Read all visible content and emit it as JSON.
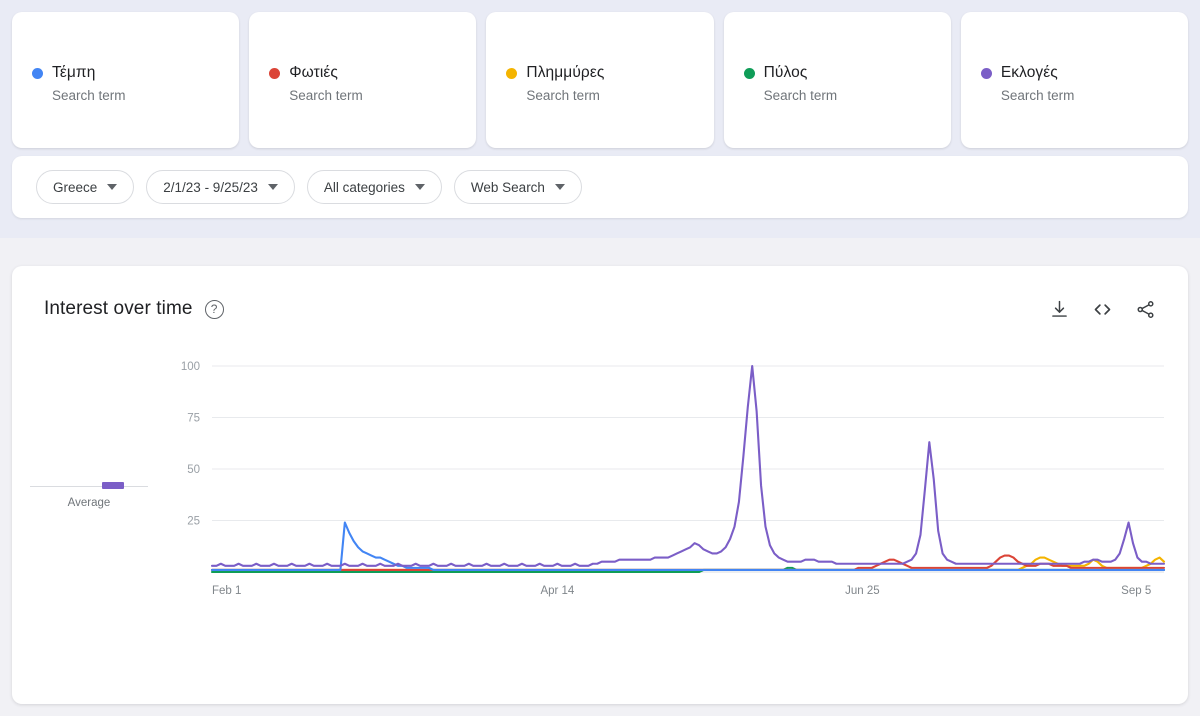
{
  "terms": [
    {
      "name": "Τέμπη",
      "subtitle": "Search term",
      "color": "#4285f4"
    },
    {
      "name": "Φωτιές",
      "subtitle": "Search term",
      "color": "#db4437"
    },
    {
      "name": "Πλημμύρες",
      "subtitle": "Search term",
      "color": "#f4b400"
    },
    {
      "name": "Πύλος",
      "subtitle": "Search term",
      "color": "#0f9d58"
    },
    {
      "name": "Εκλογές",
      "subtitle": "Search term",
      "color": "#7b5ec7"
    }
  ],
  "filters": [
    {
      "label": "Greece",
      "name": "region-filter"
    },
    {
      "label": "2/1/23 - 9/25/23",
      "name": "date-range-filter"
    },
    {
      "label": "All categories",
      "name": "category-filter"
    },
    {
      "label": "Web Search",
      "name": "search-type-filter"
    }
  ],
  "panel": {
    "title": "Interest over time",
    "help": "?",
    "average_label": "Average",
    "actions": [
      "download-icon",
      "embed-code-icon",
      "share-icon"
    ]
  },
  "chart_data": {
    "type": "line",
    "title": "Interest over time",
    "xlabel": "",
    "ylabel": "",
    "ylim": [
      0,
      100
    ],
    "yticks": [
      25,
      50,
      75,
      100
    ],
    "grid": true,
    "legend_position": "top-cards",
    "xticks": [
      "Feb 1",
      "Apr 14",
      "Jun 25",
      "Sep 5"
    ],
    "xtick_positions": [
      0,
      0.345,
      0.665,
      0.955
    ],
    "date_range": "2/1/23 - 9/25/23",
    "region": "Greece",
    "series": [
      {
        "name": "Τέμπη",
        "color": "#4285f4",
        "values": [
          1,
          1,
          1,
          1,
          1,
          1,
          1,
          1,
          1,
          1,
          1,
          1,
          1,
          1,
          1,
          1,
          1,
          1,
          1,
          1,
          1,
          1,
          1,
          1,
          1,
          1,
          1,
          1,
          1,
          1,
          24,
          19,
          15,
          12,
          10,
          9,
          8,
          7,
          7,
          6,
          5,
          4,
          3,
          3,
          2,
          2,
          2,
          2,
          2,
          2,
          1,
          1,
          1,
          1,
          1,
          1,
          1,
          1,
          1,
          1,
          1,
          1,
          1,
          1,
          1,
          1,
          1,
          1,
          1,
          1,
          1,
          1,
          1,
          1,
          1,
          1,
          1,
          1,
          1,
          1,
          1,
          1,
          1,
          1,
          1,
          1,
          1,
          1,
          1,
          1,
          1,
          1,
          1,
          1,
          1,
          1,
          1,
          1,
          1,
          1,
          1,
          1,
          1,
          1,
          1,
          1,
          1,
          1,
          1,
          1,
          1,
          1,
          1,
          1,
          1,
          1,
          1,
          1,
          1,
          1,
          1,
          1,
          1,
          1,
          1,
          1,
          1,
          1,
          1,
          1,
          1,
          1,
          1,
          1,
          1,
          1,
          1,
          1,
          1,
          1,
          1,
          1,
          1,
          1,
          1,
          1,
          1,
          1,
          1,
          1,
          1,
          1,
          1,
          1,
          1,
          1,
          1,
          1,
          1,
          1,
          1,
          1,
          1,
          1,
          1,
          1,
          1,
          1,
          1,
          1,
          1,
          1,
          1,
          1,
          1,
          1,
          1,
          1,
          1,
          1,
          1,
          1,
          1,
          1,
          1,
          1,
          1,
          1,
          1,
          1,
          1,
          1,
          1,
          1,
          1,
          1,
          1,
          1,
          1,
          1,
          1,
          1,
          1,
          1,
          1,
          1,
          1,
          1,
          1,
          1,
          1,
          1,
          1,
          1,
          1,
          1
        ]
      },
      {
        "name": "Φωτιές",
        "color": "#db4437",
        "values": [
          1,
          1,
          1,
          1,
          1,
          1,
          1,
          1,
          1,
          1,
          1,
          1,
          1,
          1,
          1,
          1,
          1,
          1,
          1,
          1,
          1,
          1,
          1,
          1,
          1,
          1,
          1,
          1,
          1,
          1,
          1,
          1,
          1,
          1,
          1,
          1,
          1,
          1,
          1,
          1,
          1,
          1,
          1,
          1,
          1,
          1,
          1,
          1,
          1,
          1,
          1,
          1,
          1,
          1,
          1,
          1,
          1,
          1,
          1,
          1,
          1,
          1,
          1,
          1,
          1,
          1,
          1,
          1,
          1,
          1,
          1,
          1,
          1,
          1,
          1,
          1,
          1,
          1,
          1,
          1,
          1,
          1,
          1,
          1,
          1,
          1,
          1,
          1,
          1,
          1,
          1,
          1,
          1,
          1,
          1,
          1,
          1,
          1,
          1,
          1,
          1,
          1,
          1,
          1,
          1,
          1,
          1,
          1,
          1,
          1,
          1,
          1,
          1,
          1,
          1,
          1,
          1,
          1,
          1,
          1,
          1,
          1,
          1,
          1,
          1,
          1,
          1,
          1,
          1,
          1,
          1,
          1,
          1,
          1,
          1,
          1,
          1,
          1,
          1,
          1,
          1,
          1,
          1,
          1,
          1,
          1,
          2,
          2,
          2,
          2,
          3,
          4,
          5,
          6,
          6,
          5,
          4,
          3,
          2,
          2,
          2,
          2,
          2,
          2,
          2,
          2,
          2,
          2,
          2,
          2,
          2,
          2,
          2,
          2,
          2,
          2,
          3,
          5,
          7,
          8,
          8,
          7,
          5,
          4,
          3,
          3,
          3,
          4,
          4,
          4,
          3,
          3,
          3,
          3,
          2,
          2,
          2,
          2,
          2,
          2,
          2,
          2,
          2,
          2,
          2,
          2,
          2,
          2,
          2,
          2,
          2,
          2,
          2,
          2,
          2,
          2
        ]
      },
      {
        "name": "Πλημμύρες",
        "color": "#f4b400",
        "values": [
          1,
          1,
          1,
          1,
          1,
          1,
          1,
          1,
          1,
          1,
          1,
          1,
          1,
          1,
          1,
          1,
          1,
          1,
          1,
          1,
          1,
          1,
          1,
          1,
          1,
          1,
          1,
          1,
          1,
          1,
          1,
          1,
          1,
          1,
          1,
          1,
          1,
          1,
          1,
          1,
          1,
          1,
          1,
          1,
          1,
          1,
          1,
          1,
          1,
          1,
          1,
          1,
          1,
          1,
          1,
          1,
          1,
          1,
          1,
          1,
          1,
          1,
          1,
          1,
          1,
          1,
          1,
          1,
          1,
          1,
          1,
          1,
          1,
          1,
          1,
          1,
          1,
          1,
          1,
          1,
          1,
          1,
          1,
          1,
          1,
          1,
          1,
          1,
          1,
          1,
          1,
          1,
          1,
          1,
          1,
          1,
          1,
          1,
          1,
          1,
          1,
          1,
          1,
          1,
          1,
          1,
          1,
          1,
          1,
          1,
          1,
          1,
          1,
          1,
          1,
          1,
          1,
          1,
          1,
          1,
          1,
          1,
          1,
          1,
          1,
          1,
          1,
          1,
          1,
          1,
          1,
          1,
          1,
          1,
          1,
          1,
          1,
          1,
          1,
          1,
          1,
          1,
          1,
          1,
          1,
          1,
          1,
          1,
          1,
          1,
          1,
          1,
          1,
          1,
          1,
          1,
          1,
          1,
          1,
          1,
          1,
          1,
          1,
          1,
          1,
          1,
          1,
          1,
          1,
          1,
          1,
          1,
          1,
          1,
          1,
          1,
          1,
          1,
          1,
          1,
          1,
          1,
          1,
          2,
          3,
          4,
          6,
          7,
          7,
          6,
          5,
          4,
          3,
          3,
          3,
          3,
          3,
          3,
          4,
          6,
          5,
          3,
          2,
          2,
          2,
          2,
          2,
          2,
          2,
          2,
          2,
          3,
          4,
          6,
          7,
          5
        ]
      },
      {
        "name": "Πύλος",
        "color": "#0f9d58",
        "values": [
          0,
          0,
          0,
          0,
          0,
          0,
          0,
          0,
          0,
          0,
          0,
          0,
          0,
          0,
          0,
          0,
          0,
          0,
          0,
          0,
          0,
          0,
          0,
          0,
          0,
          0,
          0,
          0,
          0,
          0,
          0,
          0,
          0,
          0,
          0,
          0,
          0,
          0,
          0,
          0,
          0,
          0,
          0,
          0,
          0,
          0,
          0,
          0,
          0,
          0,
          0,
          0,
          0,
          0,
          0,
          0,
          0,
          0,
          0,
          0,
          0,
          0,
          0,
          0,
          0,
          0,
          0,
          0,
          0,
          0,
          0,
          0,
          0,
          0,
          0,
          0,
          0,
          0,
          0,
          0,
          0,
          0,
          0,
          0,
          0,
          0,
          0,
          0,
          0,
          0,
          0,
          0,
          0,
          0,
          0,
          0,
          0,
          0,
          0,
          0,
          0,
          0,
          0,
          0,
          0,
          0,
          0,
          0,
          0,
          0,
          0,
          1,
          1,
          1,
          1,
          1,
          1,
          1,
          1,
          1,
          1,
          1,
          1,
          1,
          1,
          1,
          1,
          1,
          1,
          1,
          2,
          2,
          1,
          1,
          1,
          1,
          1,
          1,
          1,
          1,
          1,
          1,
          1,
          1,
          1,
          1,
          1,
          1,
          1,
          1,
          1,
          1,
          1,
          1,
          1,
          1,
          1,
          1,
          1,
          1,
          1,
          1,
          1,
          1,
          1,
          1,
          1,
          1,
          1,
          1,
          1,
          1,
          1,
          1,
          1,
          1,
          1,
          1,
          1,
          1,
          1,
          1,
          1,
          1,
          1,
          1,
          1,
          1,
          1,
          1,
          1,
          1,
          1,
          1,
          1,
          1,
          1,
          1,
          1,
          1,
          1,
          1,
          1,
          1,
          1,
          1,
          1,
          1,
          1,
          1,
          1,
          1,
          1,
          1,
          1,
          1
        ]
      },
      {
        "name": "Εκλογές",
        "color": "#7b5ec7",
        "values": [
          3,
          3,
          4,
          3,
          3,
          3,
          4,
          3,
          3,
          3,
          4,
          3,
          3,
          3,
          4,
          3,
          3,
          3,
          4,
          3,
          3,
          3,
          4,
          3,
          3,
          3,
          4,
          3,
          3,
          3,
          4,
          3,
          3,
          3,
          4,
          3,
          3,
          3,
          4,
          3,
          3,
          3,
          4,
          3,
          3,
          3,
          4,
          3,
          3,
          3,
          4,
          3,
          3,
          3,
          4,
          3,
          3,
          3,
          4,
          3,
          3,
          3,
          4,
          3,
          3,
          3,
          4,
          3,
          3,
          3,
          4,
          3,
          3,
          3,
          4,
          3,
          3,
          3,
          4,
          3,
          3,
          3,
          4,
          3,
          3,
          3,
          4,
          4,
          5,
          5,
          5,
          5,
          6,
          6,
          6,
          6,
          6,
          6,
          6,
          6,
          7,
          7,
          7,
          7,
          8,
          9,
          10,
          11,
          12,
          14,
          13,
          11,
          10,
          9,
          9,
          10,
          12,
          16,
          22,
          34,
          56,
          80,
          100,
          78,
          42,
          22,
          13,
          9,
          7,
          6,
          5,
          5,
          5,
          5,
          6,
          6,
          6,
          5,
          5,
          5,
          5,
          4,
          4,
          4,
          4,
          4,
          4,
          4,
          4,
          4,
          4,
          4,
          4,
          4,
          4,
          4,
          4,
          5,
          6,
          9,
          18,
          40,
          63,
          45,
          20,
          9,
          6,
          5,
          4,
          4,
          4,
          4,
          4,
          4,
          4,
          4,
          4,
          4,
          4,
          4,
          4,
          4,
          4,
          4,
          4,
          4,
          4,
          4,
          4,
          4,
          4,
          4,
          4,
          4,
          4,
          4,
          4,
          5,
          5,
          6,
          6,
          5,
          5,
          5,
          6,
          9,
          16,
          24,
          14,
          7,
          5,
          5,
          4,
          4,
          4,
          4
        ]
      }
    ]
  }
}
